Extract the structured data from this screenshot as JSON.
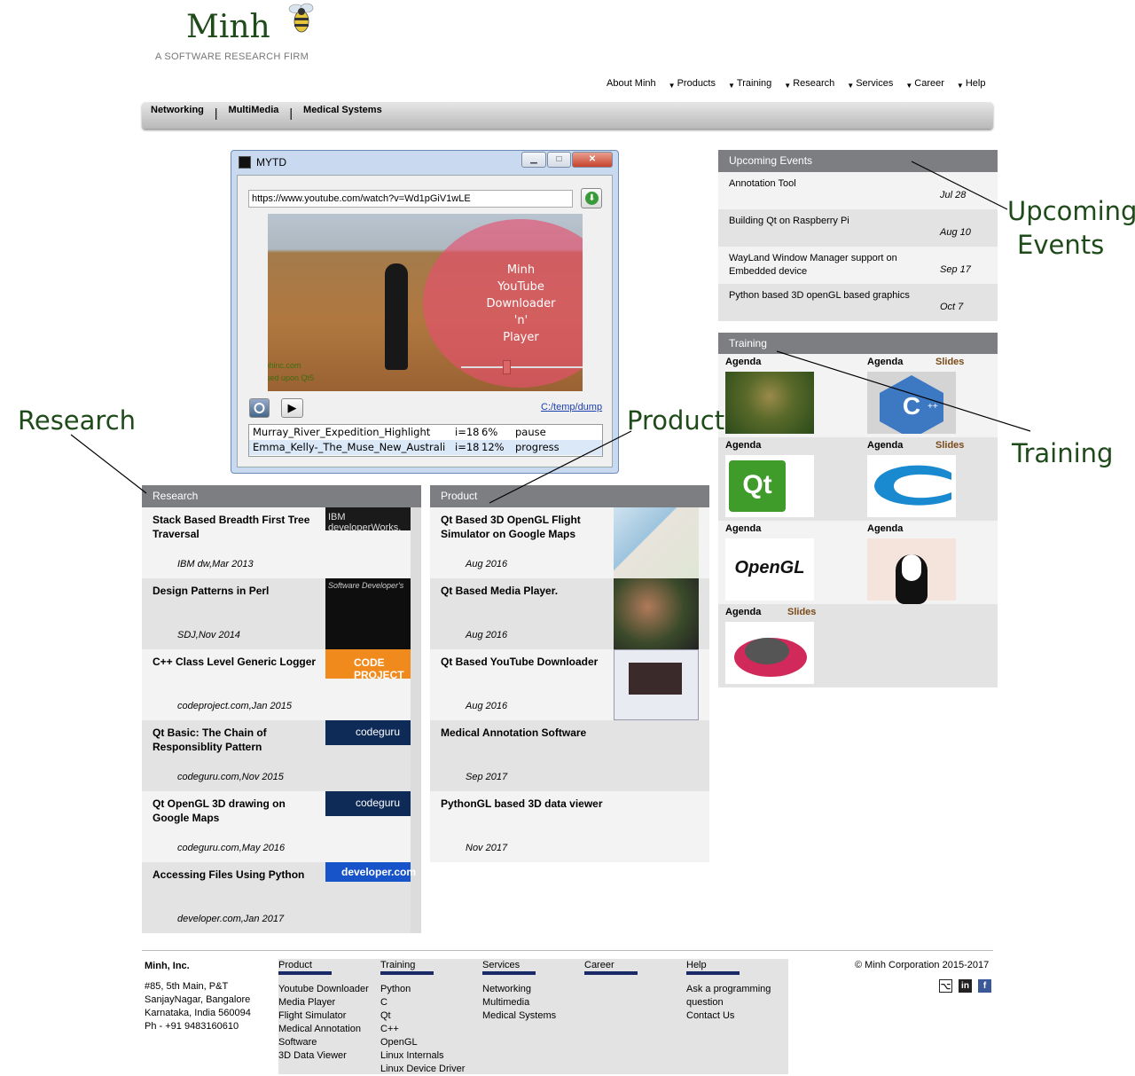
{
  "brand": {
    "name": "Minh",
    "tagline": "A SOFTWARE RESEARCH FIRM"
  },
  "topnav": [
    "About Minh",
    "Products",
    "Training",
    "Research",
    "Services",
    "Career",
    "Help"
  ],
  "subnav": [
    "Networking",
    "MultiMedia",
    "Medical Systems"
  ],
  "app_window": {
    "title": "MYTD",
    "url": "https://www.youtube.com/watch?v=Wd1pGiV1wLE",
    "overlay_lines": [
      "Minh",
      "YouTube",
      "Downloader",
      "'n'",
      "Player"
    ],
    "watermark": [
      "minhinc.com",
      "Based upon Qt5"
    ],
    "folder_link": "C:/temp/dump",
    "downloads": [
      {
        "name": "Murray_River_Expedition_Highlight",
        "index": "i=18",
        "percent": "6%",
        "status": "pause"
      },
      {
        "name": "Emma_Kelly-_The_Muse_New_Australi",
        "index": "i=18",
        "percent": "12%",
        "status": "progress"
      }
    ]
  },
  "research": {
    "header": "Research",
    "items": [
      {
        "title": "Stack Based Breadth First Tree Traversal",
        "date": "IBM dw,Mar 2013",
        "thumb": "IBM developerWorks."
      },
      {
        "title": "Design Patterns in Perl",
        "date": "SDJ,Nov 2014",
        "thumb": "Software Developer's"
      },
      {
        "title": "C++ Class Level Generic Logger",
        "date": "codeproject.com,Jan 2015",
        "thumb": "CODE PROJECT"
      },
      {
        "title": "Qt Basic: The Chain of Responsiblity Pattern",
        "date": "codeguru.com,Nov 2015",
        "thumb": "codeguru"
      },
      {
        "title": "Qt OpenGL 3D drawing on Google Maps",
        "date": "codeguru.com,May 2016",
        "thumb": "codeguru"
      },
      {
        "title": "Accessing Files Using Python",
        "date": "developer.com,Jan 2017",
        "thumb": "developer.com"
      }
    ]
  },
  "product": {
    "header": "Product",
    "items": [
      {
        "title": "Qt Based 3D OpenGL Flight Simulator on Google Maps",
        "date": "Aug 2016"
      },
      {
        "title": "Qt Based Media Player.",
        "date": "Aug 2016"
      },
      {
        "title": "Qt Based YouTube Downloader",
        "date": "Aug 2016"
      },
      {
        "title": "Medical Annotation Software",
        "date": "Sep 2017"
      },
      {
        "title": "PythonGL based 3D data viewer",
        "date": "Nov 2017"
      }
    ]
  },
  "events": {
    "header": "Upcoming Events",
    "items": [
      {
        "title": "Annotation Tool",
        "date": "Jul 28"
      },
      {
        "title": "Building Qt on Raspberry Pi",
        "date": "Aug 10"
      },
      {
        "title": "WayLand Window Manager support on Embedded device",
        "date": "Sep 17"
      },
      {
        "title": "Python based 3D openGL based graphics",
        "date": "Oct 7"
      }
    ]
  },
  "training": {
    "header": "Training",
    "agenda_label": "Agenda",
    "slides_label": "Slides",
    "image_labels": [
      "Python",
      "C++",
      "Qt",
      "C",
      "OpenGL",
      "Linux"
    ]
  },
  "annotations": {
    "research": "Research",
    "product": "Product",
    "events_1": "Upcoming",
    "events_2": "Events",
    "training": "Training"
  },
  "footer": {
    "company": {
      "name": "Minh, Inc.",
      "lines": [
        "#85, 5th Main, P&T",
        "SanjayNagar, Bangalore",
        "Karnataka, India 560094",
        "Ph - +91 9483160610"
      ]
    },
    "columns": [
      {
        "heading": "Product",
        "links": [
          "Youtube Downloader",
          "Media Player",
          "Flight Simulator",
          "Medical Annotation",
          "Software",
          "3D Data Viewer"
        ]
      },
      {
        "heading": "Training",
        "links": [
          "Python",
          "C",
          "Qt",
          "C++",
          "OpenGL",
          "Linux Internals",
          "Linux Device Driver"
        ]
      },
      {
        "heading": "Services",
        "links": [
          "Networking",
          "Multimedia",
          "Medical Systems"
        ]
      },
      {
        "heading": "Career",
        "links": []
      },
      {
        "heading": "Help",
        "links": [
          "Ask a programming",
          "question",
          "Contact Us"
        ]
      }
    ],
    "copyright": "© Minh Corporation 2015-2017",
    "social": [
      "github-icon",
      "linkedin-icon",
      "facebook-icon"
    ]
  }
}
